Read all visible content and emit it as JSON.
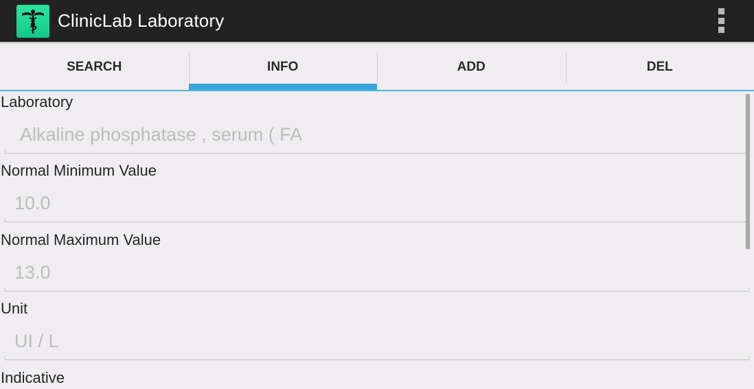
{
  "app": {
    "title": "ClinicLab Laboratory",
    "icon": "caduceus-icon",
    "colors": {
      "actionbar": "#222222",
      "accent": "#36a6db",
      "icon_bg": "#1fd595"
    }
  },
  "menu": {
    "icon": "overflow-menu-icon"
  },
  "tabs": [
    {
      "label": "SEARCH",
      "selected": false
    },
    {
      "label": "INFO",
      "selected": true
    },
    {
      "label": "ADD",
      "selected": false
    },
    {
      "label": "DEL",
      "selected": false
    }
  ],
  "form": {
    "laboratory": {
      "label": "Laboratory",
      "value": "Alkaline phosphatase , serum ( FA"
    },
    "normal_min": {
      "label": "Normal Minimum Value",
      "value": "10.0"
    },
    "normal_max": {
      "label": "Normal Maximum Value",
      "value": "13.0"
    },
    "unit": {
      "label": "Unit",
      "value": "UI / L"
    },
    "indicative": {
      "label": "Indicative"
    }
  }
}
